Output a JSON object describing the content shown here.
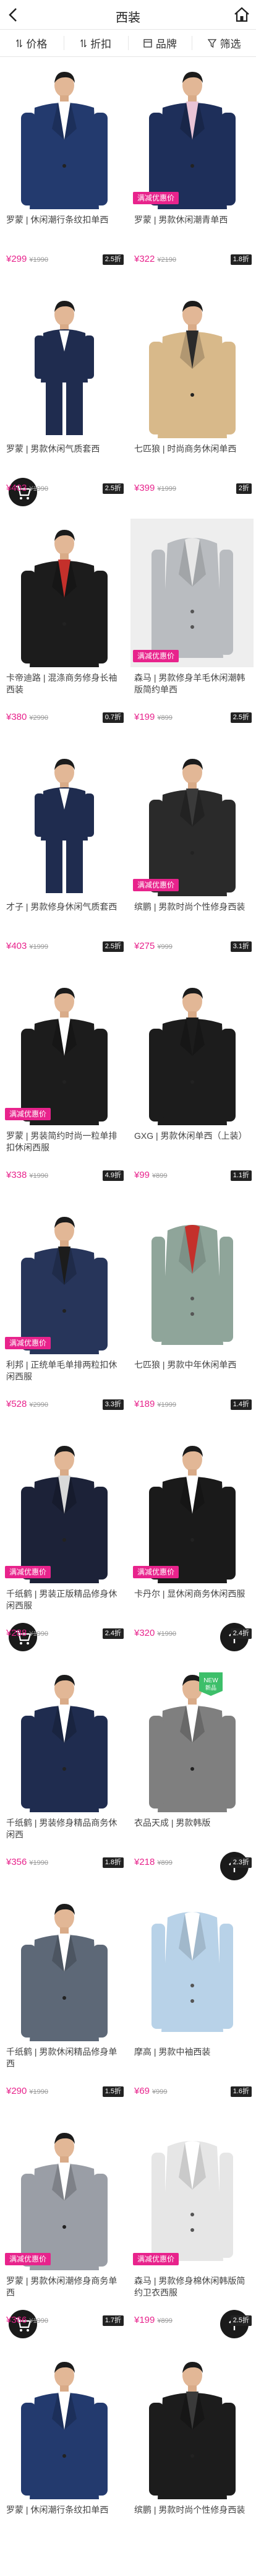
{
  "header": {
    "title": "西装"
  },
  "sortbar": {
    "items": [
      "价格",
      "折扣",
      "品牌",
      "筛选"
    ]
  },
  "colors": {
    "accent": "#e8238c",
    "badge_bg": "#222222"
  },
  "products": [
    {
      "name": "罗蒙 | 休闲潮行条纹扣单西",
      "price": "¥299",
      "old": "¥1990",
      "sales": "2.5折",
      "tag": "",
      "cart": false,
      "top": false,
      "new": false,
      "suit": "#233a6e",
      "shirt": "#ffffff",
      "bg": "#ffffff",
      "style": "suit"
    },
    {
      "name": "罗蒙 | 男款休闲潮青单西",
      "price": "¥322",
      "old": "¥2190",
      "sales": "1.8折",
      "tag": "满减优惠价",
      "cart": false,
      "top": false,
      "new": false,
      "suit": "#1e2f5a",
      "shirt": "#e9c4d6",
      "bg": "#ffffff",
      "style": "suit"
    },
    {
      "name": "罗蒙 | 男款休闲气质套西",
      "price": "¥403",
      "old": "¥1990",
      "sales": "2.5折",
      "tag": "",
      "cart": true,
      "top": false,
      "new": false,
      "suit": "#1f2c4f",
      "shirt": "#ffffff",
      "bg": "#ffffff",
      "style": "full"
    },
    {
      "name": "七匹狼 | 时尚商务休闲单西",
      "price": "¥399",
      "old": "¥1999",
      "sales": "2折",
      "tag": "",
      "cart": false,
      "top": false,
      "new": false,
      "suit": "#d8b98a",
      "shirt": "#2a2a2a",
      "bg": "#ffffff",
      "style": "suit"
    },
    {
      "name": "卡帝迪路 | 混涤商务修身长袖西装",
      "price": "¥380",
      "old": "¥2990",
      "sales": "0.7折",
      "tag": "",
      "cart": false,
      "top": false,
      "new": false,
      "suit": "#1c1c1c",
      "shirt": "#c4302b",
      "bg": "#ffffff",
      "style": "suit"
    },
    {
      "name": "森马 | 男款修身羊毛休闲潮韩版简约单西",
      "price": "¥199",
      "old": "¥899",
      "sales": "2.5折",
      "tag": "满减优惠价",
      "cart": false,
      "top": false,
      "new": false,
      "suit": "#b9bcc0",
      "shirt": "#e8e8e8",
      "bg": "#eeeeee",
      "style": "jacket"
    },
    {
      "name": "才子 | 男款修身休闲气质套西",
      "price": "¥403",
      "old": "¥1999",
      "sales": "2.5折",
      "tag": "",
      "cart": false,
      "top": false,
      "new": false,
      "suit": "#1f2c4f",
      "shirt": "#ffffff",
      "bg": "#ffffff",
      "style": "full"
    },
    {
      "name": "缤鹏 | 男款时尚个性修身西装",
      "price": "¥275",
      "old": "¥999",
      "sales": "3.1折",
      "tag": "满减优惠价",
      "cart": false,
      "top": false,
      "new": false,
      "suit": "#2a2a2a",
      "shirt": "#3a3a3a",
      "bg": "#ffffff",
      "style": "suit"
    },
    {
      "name": "罗蒙 | 男装简约时尚一粒单排扣休闲西服",
      "price": "¥338",
      "old": "¥1990",
      "sales": "4.9折",
      "tag": "满减优惠价",
      "cart": false,
      "top": false,
      "new": false,
      "suit": "#1c1c1c",
      "shirt": "#ffffff",
      "bg": "#ffffff",
      "style": "suit"
    },
    {
      "name": "GXG | 男款休闲单西（上装）",
      "price": "¥99",
      "old": "¥899",
      "sales": "1.1折",
      "tag": "",
      "cart": false,
      "top": false,
      "new": false,
      "suit": "#1c1c1c",
      "shirt": "#1c1c1c",
      "bg": "#ffffff",
      "style": "suit"
    },
    {
      "name": "利邦 | 正统单毛单排两粒扣休闲西服",
      "price": "¥528",
      "old": "¥2990",
      "sales": "3.3折",
      "tag": "满减优惠价",
      "cart": false,
      "top": false,
      "new": false,
      "suit": "#27355a",
      "shirt": "#1c1c1c",
      "bg": "#ffffff",
      "style": "suit"
    },
    {
      "name": "七匹狼 | 男款中年休闲单西",
      "price": "¥189",
      "old": "¥1999",
      "sales": "1.4折",
      "tag": "",
      "cart": false,
      "top": false,
      "new": false,
      "suit": "#8fa59a",
      "shirt": "#c4302b",
      "bg": "#ffffff",
      "style": "jacket"
    },
    {
      "name": "千纸鹤 | 男装正版精品修身休闲西服",
      "price": "¥288",
      "old": "¥1990",
      "sales": "2.4折",
      "tag": "满减优惠价",
      "cart": true,
      "top": false,
      "new": false,
      "suit": "#1c2238",
      "shirt": "#d9d9d9",
      "bg": "#ffffff",
      "style": "suit"
    },
    {
      "name": "卡丹尔 | 显休闲商务休闲西服",
      "price": "¥320",
      "old": "¥1990",
      "sales": "2.4折",
      "tag": "满减优惠价",
      "cart": false,
      "top": true,
      "new": false,
      "suit": "#1a1a1a",
      "shirt": "#ffffff",
      "bg": "#ffffff",
      "style": "suit"
    },
    {
      "name": "千纸鹤 | 男装修身精品商务休闲西",
      "price": "¥356",
      "old": "¥1990",
      "sales": "1.8折",
      "tag": "",
      "cart": false,
      "top": false,
      "new": false,
      "suit": "#1f2c4f",
      "shirt": "#ffffff",
      "bg": "#ffffff",
      "style": "suit"
    },
    {
      "name": "衣品天成 | 男款韩版",
      "price": "¥218",
      "old": "¥899",
      "sales": "2.3折",
      "tag": "",
      "cart": false,
      "top": true,
      "new": true,
      "suit": "#7f7f7f",
      "shirt": "#ffffff",
      "bg": "#ffffff",
      "style": "suit"
    },
    {
      "name": "千纸鹤 | 男款休闲精品修身单西",
      "price": "¥290",
      "old": "¥1990",
      "sales": "1.5折",
      "tag": "",
      "cart": false,
      "top": false,
      "new": false,
      "suit": "#5d6877",
      "shirt": "#ffffff",
      "bg": "#ffffff",
      "style": "suit"
    },
    {
      "name": "摩高 | 男款中袖西装",
      "price": "¥69",
      "old": "¥999",
      "sales": "1.6折",
      "tag": "",
      "cart": false,
      "top": false,
      "new": false,
      "suit": "#b8d2e8",
      "shirt": "#ffffff",
      "bg": "#ffffff",
      "style": "jacket"
    },
    {
      "name": "罗蒙 | 男款休闲潮修身商务单西",
      "price": "¥366",
      "old": "¥1990",
      "sales": "1.7折",
      "tag": "满减优惠价",
      "cart": true,
      "top": false,
      "new": false,
      "suit": "#9a9ea6",
      "shirt": "#ffffff",
      "bg": "#ffffff",
      "style": "suit"
    },
    {
      "name": "森马 | 男款修身棉休闲韩版简约卫衣西服",
      "price": "¥199",
      "old": "¥899",
      "sales": "2.5折",
      "tag": "满减优惠价",
      "cart": false,
      "top": true,
      "new": false,
      "suit": "#e6e6e6",
      "shirt": "#ffffff",
      "bg": "#ffffff",
      "style": "jacket"
    },
    {
      "name": "罗蒙 | 休闲潮行条纹扣单西",
      "price": "",
      "old": "",
      "sales": "",
      "tag": "",
      "cart": false,
      "top": false,
      "new": false,
      "suit": "#233a6e",
      "shirt": "#ffffff",
      "bg": "#ffffff",
      "style": "suit"
    },
    {
      "name": "缤鹏 | 男款时尚个性修身西装",
      "price": "",
      "old": "",
      "sales": "",
      "tag": "",
      "cart": false,
      "top": false,
      "new": false,
      "suit": "#1c1c1c",
      "shirt": "#3a3a3a",
      "bg": "#ffffff",
      "style": "suit"
    }
  ]
}
